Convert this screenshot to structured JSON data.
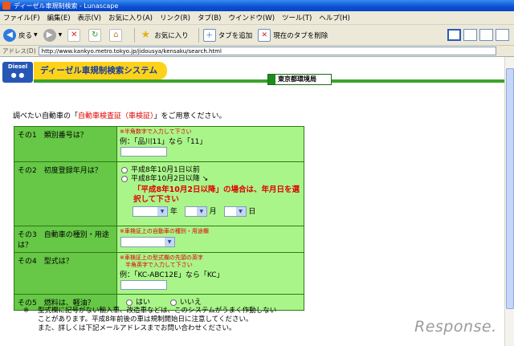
{
  "window": {
    "title": "ディーゼル車規制検索 - Lunascape"
  },
  "menu": [
    "ファイル(F)",
    "編集(E)",
    "表示(V)",
    "お気に入り(A)",
    "リンク(R)",
    "タブ(B)",
    "ウインドウ(W)",
    "ツール(T)",
    "ヘルプ(H)"
  ],
  "toolbar": {
    "back_label": "戻る",
    "favorites_label": "お気に入り",
    "add_tab_label": "タブを追加",
    "close_tab_label": "現在のタブを削除"
  },
  "address": {
    "label": "アドレス(D)",
    "url": "http://www.kankyo.metro.tokyo.jp/jidousya/kensaku/search.html"
  },
  "site": {
    "logo_text": "Diesel",
    "title": "ディーゼル車規制検索システム",
    "department": "東京都環境局"
  },
  "intro": {
    "prefix": "調べたい自動車の「",
    "highlight": "自動車検査証（車検証）",
    "suffix": "」をご用意ください。"
  },
  "form": {
    "q1": {
      "label": "その1　類別番号は？",
      "note": "※半角数字で入力して下さい",
      "example": "例：「品川11」なら「11」"
    },
    "q2": {
      "label": "その2　初度登録年月は？",
      "option1": "平成8年10月1日以前",
      "option2": "平成8年10月2日以降 ↘",
      "note": "「平成8年10月2日以降」の場合は、年月日を選択して下さい",
      "year": "年",
      "month": "月",
      "day": "日"
    },
    "q3": {
      "label": "その3　自動車の種別・用途は？",
      "note": "※車検証上の自動車の種別・用途欄"
    },
    "q4": {
      "label": "その4　型式は？",
      "note1": "※車検証上の型式欄の先頭の英字",
      "note2": "　半角英字で入力して下さい",
      "example": "例：「KC-ABC12E」なら「KC」"
    },
    "q5": {
      "label": "その5　燃料は、軽油？",
      "yes": "はい",
      "no": "いいえ"
    }
  },
  "footer": {
    "mark": "※",
    "line1": "型式欄に記号がない輸入車、改造車などは、このシステムがうまく作動しない",
    "line2": "ことがあります。平成8年前後の車は規制開始日に注意してください。",
    "line3": "また、詳しくは下記メールアドレスまでお問い合わせください。"
  },
  "watermark": "Response."
}
